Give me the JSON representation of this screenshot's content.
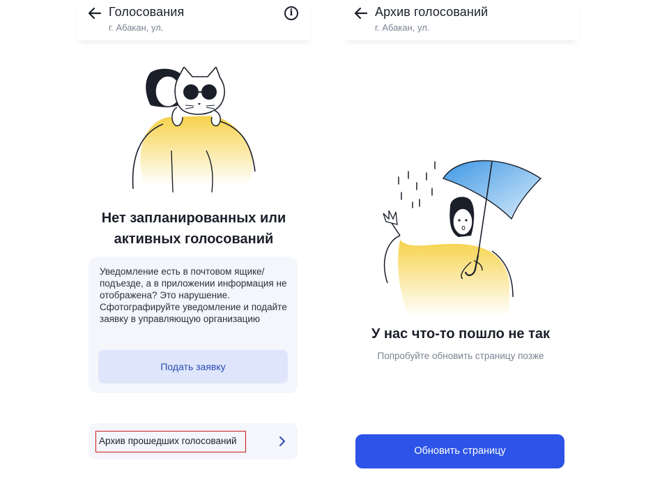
{
  "left_screen": {
    "header": {
      "title": "Голосования",
      "address": "г. Абакан, ул."
    },
    "empty_title": "Нет запланированных или активных голосований",
    "notice": {
      "text": "Уведомление есть в почтовом ящике/ подъезде, а в приложении информация не отображена? Это нарушение. Сфотографируйте уведомление и подайте заявку в управляющую организацию",
      "button_label": "Подать заявку"
    },
    "archive_link": "Архив прошедших голосований"
  },
  "right_screen": {
    "header": {
      "title": "Архив голосований",
      "address": "г. Абакан, ул."
    },
    "error_title": "У нас что-то пошло не так",
    "error_subtitle": "Попробуйте обновить страницу позже",
    "refresh_button": "Обновить страницу"
  },
  "colors": {
    "primary_blue": "#2d54e6",
    "light_button": "#dfe6fb",
    "card_bg": "#f4f6fb",
    "highlight_red": "#d01818",
    "accent_yellow": "#f6d24a",
    "umbrella_blue": "#4aa3e8"
  },
  "icons": [
    "back-arrow-icon",
    "info-icon",
    "chevron-right-icon"
  ]
}
